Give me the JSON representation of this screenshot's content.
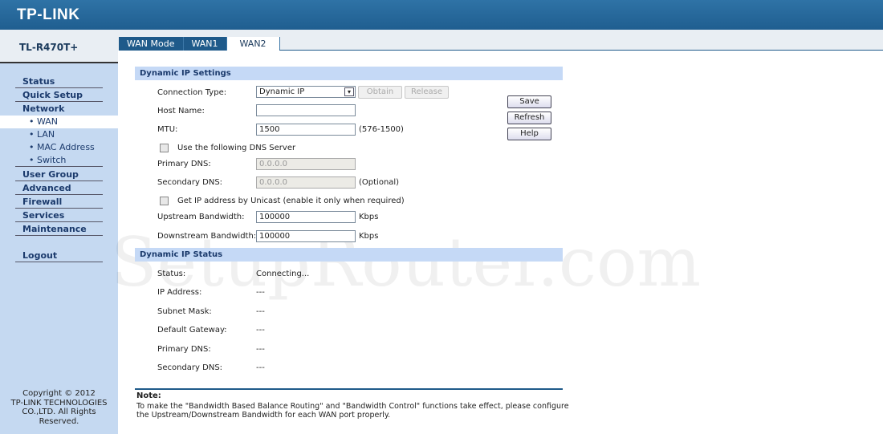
{
  "brand": "TP-LINK",
  "model": "TL-R470T+",
  "watermark": "SetupRouter.com",
  "tabs": [
    {
      "label": "WAN Mode"
    },
    {
      "label": "WAN1"
    },
    {
      "label": "WAN2",
      "active": true
    }
  ],
  "sidebar": {
    "items": [
      {
        "label": "Status"
      },
      {
        "label": "Quick Setup"
      },
      {
        "label": "Network"
      },
      {
        "label": "• WAN",
        "sub": true,
        "active": true
      },
      {
        "label": "• LAN",
        "sub": true
      },
      {
        "label": "• MAC Address",
        "sub": true
      },
      {
        "label": "• Switch",
        "sub": true
      },
      {
        "label": "User Group"
      },
      {
        "label": "Advanced"
      },
      {
        "label": "Firewall"
      },
      {
        "label": "Services"
      },
      {
        "label": "Maintenance"
      },
      {
        "label": "Logout"
      }
    ],
    "copyright": [
      "Copyright © 2012",
      "TP-LINK TECHNOLOGIES",
      "CO.,LTD. All Rights",
      "Reserved."
    ]
  },
  "settings": {
    "title": "Dynamic IP Settings",
    "connection_type_label": "Connection Type:",
    "connection_type": "Dynamic IP",
    "obtain": "Obtain",
    "release": "Release",
    "host_name_label": "Host Name:",
    "host_name": "",
    "mtu_label": "MTU:",
    "mtu": "1500",
    "mtu_range": "(576-1500)",
    "dns_checkbox": "Use the following DNS Server",
    "primary_dns_label": "Primary DNS:",
    "primary_dns": "0.0.0.0",
    "secondary_dns_label": "Secondary DNS:",
    "secondary_dns": "0.0.0.0",
    "optional": "(Optional)",
    "unicast_checkbox": "Get IP address by Unicast (enable it only when required)",
    "upstream_label": "Upstream Bandwidth:",
    "upstream": "100000",
    "downstream_label": "Downstream Bandwidth:",
    "downstream": "100000",
    "kbps": "Kbps"
  },
  "buttons": {
    "save": "Save",
    "refresh": "Refresh",
    "help": "Help"
  },
  "status": {
    "title": "Dynamic IP Status",
    "rows": [
      {
        "label": "Status:",
        "value": "Connecting..."
      },
      {
        "label": "IP Address:",
        "value": "---"
      },
      {
        "label": "Subnet Mask:",
        "value": "---"
      },
      {
        "label": "Default Gateway:",
        "value": "---"
      },
      {
        "label": "Primary DNS:",
        "value": "---"
      },
      {
        "label": "Secondary DNS:",
        "value": "---"
      }
    ]
  },
  "note": {
    "title": "Note:",
    "text": "To make the \"Bandwidth Based Balance Routing\" and \"Bandwidth Control\" functions take effect, please configure the Upstream/Downstream Bandwidth for each WAN port properly."
  }
}
